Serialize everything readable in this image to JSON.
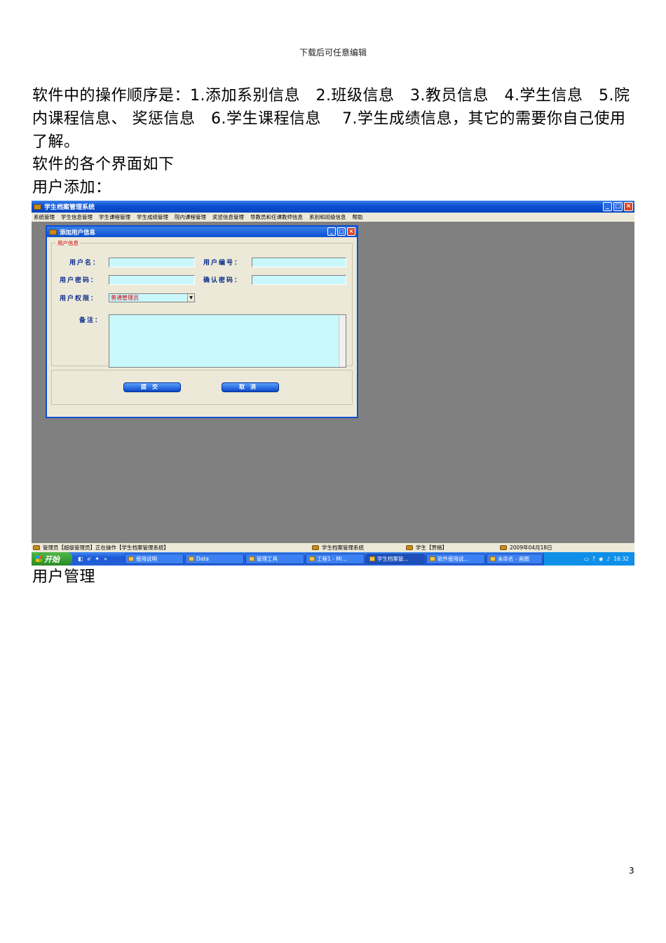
{
  "header": "下载后可任意编辑",
  "paragraphs": {
    "p1": "软件中的操作顺序是：1.添加系别信息　2.班级信息　3.教员信息　4.学生信息　5.院内课程信息、 奖惩信息　6.学生课程信息　 7.学生成绩信息，其它的需要你自己使用了解。",
    "p2": "软件的各个界面如下",
    "p3": "用户添加：",
    "p4": "用户管理"
  },
  "app": {
    "title": "学生档案管理系统",
    "menu": [
      "系统管理",
      "学生信息管理",
      "学生课程管理",
      "学生成绩管理",
      "院内课程管理",
      "奖惩信息管理",
      "导教员和任课教师信息",
      "系别和班级信息",
      "帮助"
    ],
    "window_buttons": [
      "_",
      "□",
      "×"
    ]
  },
  "dialog": {
    "title": "添加用户信息",
    "group_label": "用户信息",
    "labels": {
      "username": "用户名：",
      "user_id": "用户编号：",
      "password": "用户密码：",
      "confirm": "确认密码：",
      "permission": "用户权限：",
      "remark": "备注："
    },
    "permission_value": "普通管理员",
    "submit": "提交",
    "cancel": "取消"
  },
  "status": {
    "s1": "管理员【超级管理员】正在操作【学生档案管理系统】",
    "s2": "学生档案管理系统",
    "s3": "学生【贾楠】",
    "s4": "2009年04月18日"
  },
  "taskbar": {
    "start": "开始",
    "tasks": [
      "使用说明",
      "Data",
      "管理工具",
      "工程1 - Mi...",
      "学生档案管...",
      "软件使用说...",
      "未命名 - 画图"
    ],
    "clock": "16:32"
  },
  "page_number": "3"
}
